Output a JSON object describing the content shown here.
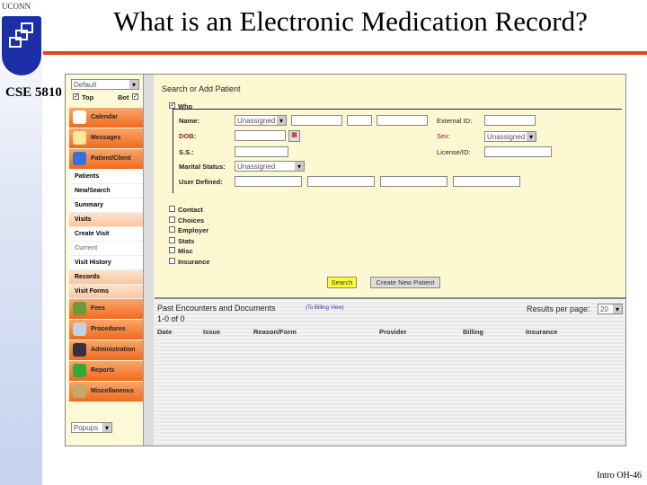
{
  "slide": {
    "title": "What is an Electronic Medication Record?",
    "course": "CSE 5810",
    "org": "UCONN",
    "footer": "Intro OH-46"
  },
  "sidebar": {
    "view_select": "Default",
    "top_label": "Top",
    "bot_label": "Bot",
    "big_items": [
      {
        "label": "Calendar",
        "icon": "calendar-icon"
      },
      {
        "label": "Messages",
        "icon": "envelope-icon"
      },
      {
        "label": "Patient/Client",
        "icon": "person-icon"
      }
    ],
    "small_items": [
      {
        "label": "Patients",
        "hl": false
      },
      {
        "label": "New/Search",
        "hl": false
      },
      {
        "label": "Summary",
        "hl": false
      },
      {
        "label": "Visits",
        "hl": true
      },
      {
        "label": "Create Visit",
        "hl": false
      },
      {
        "label": "Current",
        "hl": false
      },
      {
        "label": "Visit History",
        "hl": false
      },
      {
        "label": "Records",
        "hl": true
      },
      {
        "label": "Visit Forms",
        "hl": true
      }
    ],
    "big_items2": [
      {
        "label": "Fees",
        "icon": "money-icon"
      },
      {
        "label": "Procedures",
        "icon": "syringe-icon"
      },
      {
        "label": "Administration",
        "icon": "admin-icon"
      },
      {
        "label": "Reports",
        "icon": "chart-icon"
      },
      {
        "label": "Miscellaneous",
        "icon": "box-icon"
      }
    ],
    "popups_select": "Popups"
  },
  "search": {
    "heading": "Search or Add Patient",
    "who_label": "Who",
    "name_label": "Name:",
    "name_title": "Unassigned",
    "dob_label": "DOB:",
    "ss_label": "S.S.:",
    "marital_label": "Marital Status:",
    "marital_value": "Unassigned",
    "user_defined_label": "User Defined:",
    "external_id_label": "External ID:",
    "sex_label": "Sex:",
    "sex_value": "Unassigned",
    "license_label": "License/ID:",
    "sections": [
      "Contact",
      "Choices",
      "Employer",
      "Stats",
      "Misc",
      "Insurance"
    ],
    "search_button": "Search",
    "create_button": "Create New Patient"
  },
  "encounters": {
    "heading": "Past Encounters and Documents",
    "view_link": "(To Billing View)",
    "count": "1-0 of 0",
    "results_label": "Results per page:",
    "results_value": "20",
    "columns": [
      "Date",
      "Issue",
      "Reason/Form",
      "Provider",
      "Billing",
      "Insurance"
    ]
  }
}
